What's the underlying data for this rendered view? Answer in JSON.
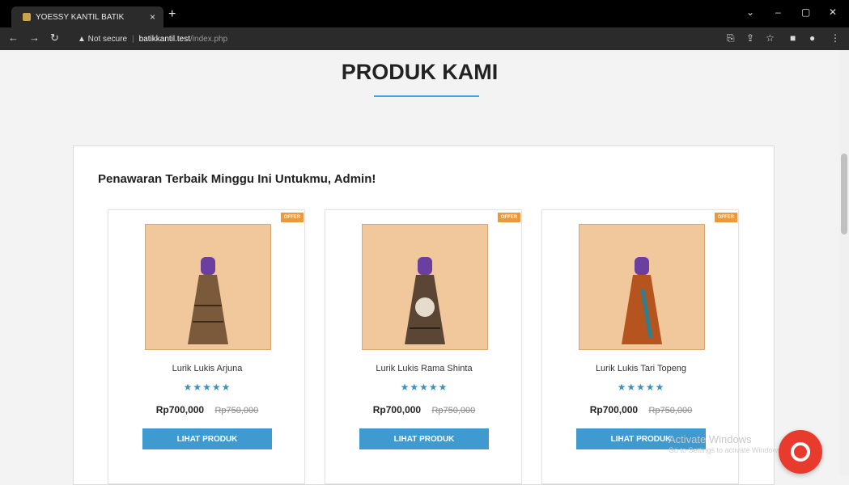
{
  "browser": {
    "tab_title": "YOESSY KANTIL BATIK",
    "tab_close": "×",
    "new_tab": "+",
    "not_secure": "▲ Not secure",
    "url_host": "batikkantil.test",
    "url_path": "/index.php"
  },
  "page": {
    "title": "PRODUK KAMI",
    "panel_heading": "Penawaran Terbaik Minggu Ini Untukmu, Admin!"
  },
  "products": [
    {
      "name": "Lurik Lukis Arjuna",
      "offer": "OFFER",
      "stars": "★★★★★",
      "rating": 5,
      "price": "Rp700,000",
      "old_price": "Rp750,000",
      "button": "LIHAT PRODUK",
      "color": "#7a5a3a"
    },
    {
      "name": "Lurik Lukis Rama Shinta",
      "offer": "OFFER",
      "stars": "★★★★★",
      "rating": 5,
      "price": "Rp700,000",
      "old_price": "Rp750,000",
      "button": "LIHAT PRODUK",
      "color": "#5b4636"
    },
    {
      "name": "Lurik Lukis Tari Topeng",
      "offer": "OFFER",
      "stars": "★★★★★",
      "rating": 5,
      "price": "Rp700,000",
      "old_price": "Rp750,000",
      "button": "LIHAT PRODUK",
      "color": "#b6541f"
    }
  ],
  "watermark": {
    "line1": "Activate Windows",
    "line2": "Go to Settings to activate Windows."
  },
  "colors": {
    "accent": "#3f9ad0",
    "offer": "#e89a3c",
    "chat": "#e83a2d"
  }
}
